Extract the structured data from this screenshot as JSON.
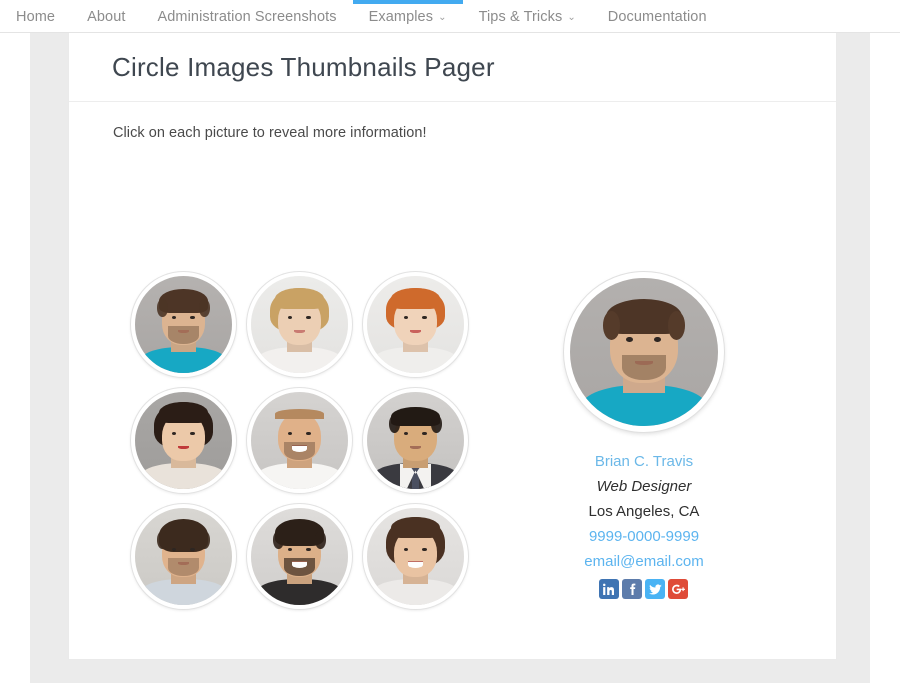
{
  "nav": {
    "items": [
      {
        "label": "Home",
        "has_caret": false,
        "active": false
      },
      {
        "label": "About",
        "has_caret": false,
        "active": false
      },
      {
        "label": "Administration Screenshots",
        "has_caret": false,
        "active": false
      },
      {
        "label": "Examples",
        "has_caret": true,
        "active": true
      },
      {
        "label": "Tips & Tricks",
        "has_caret": true,
        "active": false
      },
      {
        "label": "Documentation",
        "has_caret": false,
        "active": false
      }
    ],
    "caret_glyph": "⌄",
    "active_indicator_color": "#42aaf0"
  },
  "header": {
    "title": "Circle Images Thumbnails Pager"
  },
  "content": {
    "intro": "Click on each picture to reveal more information!"
  },
  "thumbnails": [
    {
      "name": "thumbnail-1",
      "alt": "Man in teal t-shirt",
      "selected": true
    },
    {
      "name": "thumbnail-2",
      "alt": "Blonde woman smiling",
      "selected": false
    },
    {
      "name": "thumbnail-3",
      "alt": "Red-haired woman smiling",
      "selected": false
    },
    {
      "name": "thumbnail-4",
      "alt": "Dark-haired woman",
      "selected": false
    },
    {
      "name": "thumbnail-5",
      "alt": "Bald man laughing",
      "selected": false
    },
    {
      "name": "thumbnail-6",
      "alt": "Man in suit and tie",
      "selected": false
    },
    {
      "name": "thumbnail-7",
      "alt": "Man with shaggy hair",
      "selected": false
    },
    {
      "name": "thumbnail-8",
      "alt": "Bearded man in dark jacket",
      "selected": false
    },
    {
      "name": "thumbnail-9",
      "alt": "Woman with curly hair",
      "selected": false
    }
  ],
  "profile": {
    "photo_alt": "Brian C. Travis portrait",
    "name": "Brian C. Travis",
    "role": "Web Designer",
    "location": "Los Angeles, CA",
    "phone": "9999-0000-9999",
    "email": "email@email.com",
    "socials": [
      {
        "icon": "linkedin-icon",
        "label": "LinkedIn",
        "color": "#3f74b3"
      },
      {
        "icon": "facebook-icon",
        "label": "Facebook",
        "color": "#5d7cab"
      },
      {
        "icon": "twitter-icon",
        "label": "Twitter",
        "color": "#4ab3f4"
      },
      {
        "icon": "googleplus-icon",
        "label": "Google Plus",
        "color": "#df4b38"
      }
    ]
  },
  "colors": {
    "accent": "#42aaf0",
    "link": "#5cb4ef",
    "page_bg": "#ebebeb",
    "card_bg": "#ffffff",
    "title": "#3f4750",
    "nav_text": "#8c8c8c"
  }
}
